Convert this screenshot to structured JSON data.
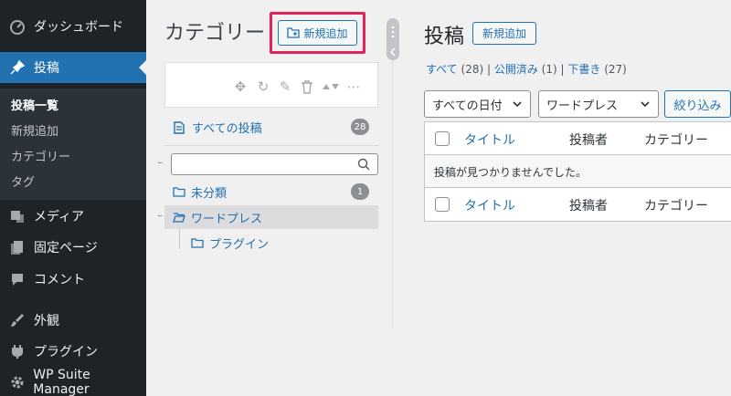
{
  "sidebar": {
    "dashboard": "ダッシュボード",
    "posts": "投稿",
    "submenu": [
      "投稿一覧",
      "新規追加",
      "カテゴリー",
      "タグ"
    ],
    "media": "メディア",
    "pages": "固定ページ",
    "comments": "コメント",
    "appearance": "外観",
    "plugins": "プラグイン",
    "wpsuite": "WP Suite Manager"
  },
  "categories": {
    "title": "カテゴリー",
    "add_new": "新規追加",
    "all_posts": "すべての投稿",
    "all_posts_count": "28",
    "uncategorized": "未分類",
    "uncategorized_count": "1",
    "wordpress": "ワードプレス",
    "plugin": "プラグイン"
  },
  "posts": {
    "title": "投稿",
    "add_new": "新規追加",
    "filter_all": "すべて",
    "filter_all_count": "(28)",
    "filter_published": "公開済み",
    "filter_published_count": "(1)",
    "filter_draft": "下書き",
    "filter_draft_count": "(27)",
    "date_select": "すべての日付",
    "category_select": "ワードプレス",
    "filter_button": "絞り込み",
    "col_title": "タイトル",
    "col_author": "投稿者",
    "col_category": "カテゴリー",
    "empty_message": "投稿が見つかりませんでした。"
  },
  "colors": {
    "accent": "#2271b1",
    "sidebar_bg": "#1d2327",
    "highlight": "#e0245e"
  }
}
